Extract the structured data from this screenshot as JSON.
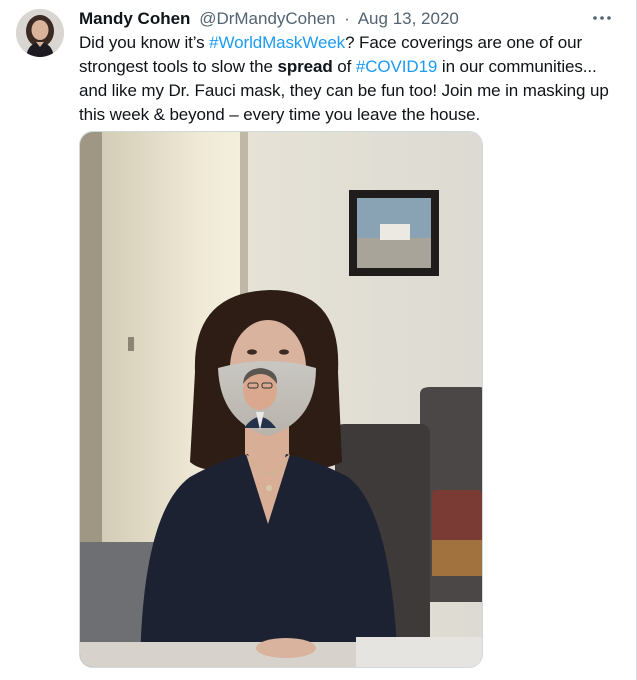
{
  "tweet": {
    "author": {
      "display_name": "Mandy Cohen",
      "handle": "@DrMandyCohen"
    },
    "separator": "·",
    "date": "Aug 13, 2020",
    "more_icon": "ellipsis-icon",
    "text": {
      "part1": "Did you know it’s ",
      "hashtag1": "#WorldMaskWeek",
      "part2": "? Face coverings are one of our strongest tools to slow the ",
      "bold": "spread",
      "part3": " of ",
      "hashtag2": "#COVID19",
      "part4": " in our communities... and like my Dr. Fauci mask, they can be fun too! Join me in masking up this week & beyond – every time you leave the house."
    },
    "colors": {
      "link": "#1d9bf0",
      "secondary_text": "#536471",
      "primary_text": "#0f1419"
    }
  }
}
